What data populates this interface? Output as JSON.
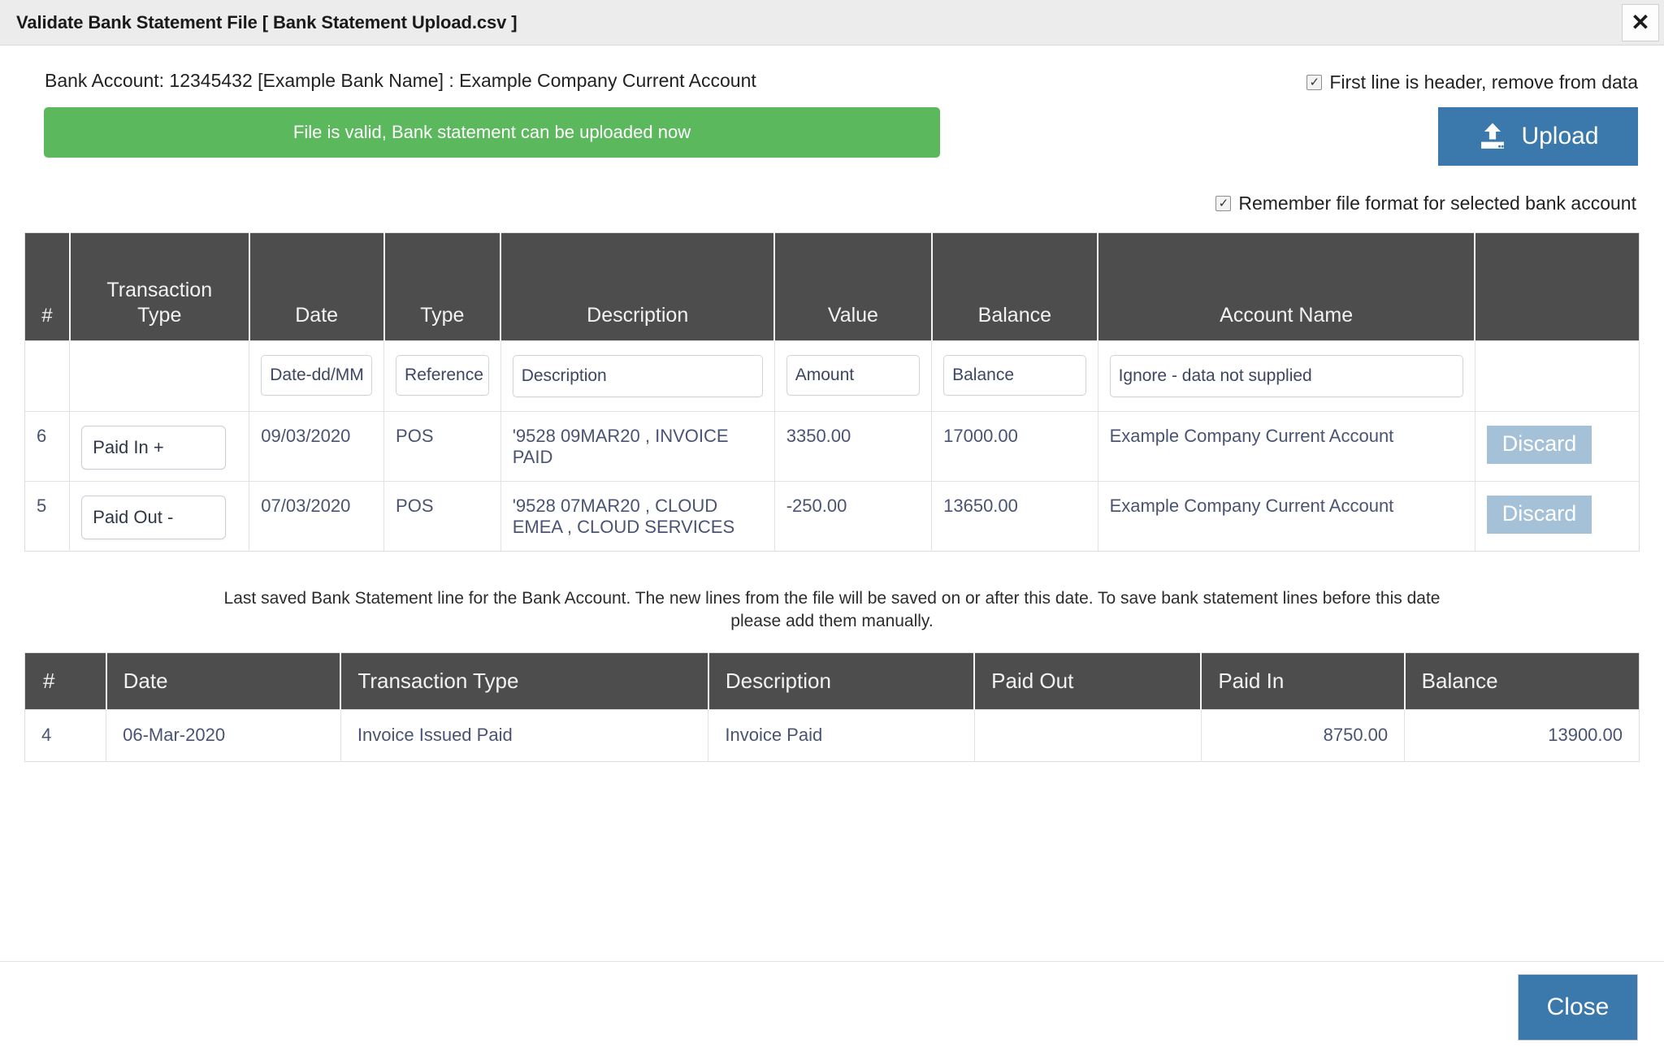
{
  "titlebar": {
    "title": "Validate Bank Statement File [ Bank Statement Upload.csv ]",
    "close_icon": "close-icon",
    "close_glyph": "✕"
  },
  "header": {
    "account_line": "Bank Account: 12345432 [Example Bank Name] : Example Company Current Account",
    "first_line_header_label": "First line is header, remove from data",
    "first_line_header_checked": true,
    "remember_format_label": "Remember file format for selected bank account",
    "remember_format_checked": true
  },
  "banner": {
    "message": "File is valid, Bank statement can be uploaded now",
    "color": "#5cb85c"
  },
  "upload": {
    "label": "Upload",
    "icon": "upload-icon",
    "color": "#3b78ab"
  },
  "mapping_table": {
    "columns": [
      "#",
      "Transaction\nType",
      "Date",
      "Type",
      "Description",
      "Value",
      "Balance",
      "Account Name",
      ""
    ],
    "column_labels": {
      "num": "#",
      "transaction_type_l1": "Transaction",
      "transaction_type_l2": "Type",
      "date": "Date",
      "type": "Type",
      "description": "Description",
      "value": "Value",
      "balance": "Balance",
      "account_name": "Account Name",
      "actions": ""
    },
    "mapping_row": {
      "num": "",
      "transaction_type": "",
      "date": "Date-dd/MM",
      "type": "Reference",
      "description": "Description",
      "value": "Amount",
      "balance": "Balance",
      "account_name": "Ignore - data not supplied",
      "actions": ""
    },
    "rows": [
      {
        "num": "6",
        "transaction_type": "Paid In  +",
        "date": "09/03/2020",
        "type": "POS",
        "description": "'9528 09MAR20 , INVOICE PAID",
        "value": "3350.00",
        "balance": "17000.00",
        "account_name": "Example Company Current Account",
        "action_label": "Discard"
      },
      {
        "num": "5",
        "transaction_type": "Paid Out  -",
        "date": "07/03/2020",
        "type": "POS",
        "description": "'9528 07MAR20 , CLOUD EMEA , CLOUD SERVICES",
        "value": "-250.00",
        "balance": "13650.00",
        "account_name": "Example Company Current Account",
        "action_label": "Discard"
      }
    ]
  },
  "note": "Last saved Bank Statement line for the Bank Account. The new lines from the file will be saved on or after this date. To save bank statement lines before this date please add them manually.",
  "saved_table": {
    "columns": {
      "num": "#",
      "date": "Date",
      "transaction_type": "Transaction Type",
      "description": "Description",
      "paid_out": "Paid Out",
      "paid_in": "Paid In",
      "balance": "Balance"
    },
    "rows": [
      {
        "num": "4",
        "date": "06-Mar-2020",
        "transaction_type": "Invoice Issued Paid",
        "description": "Invoice Paid",
        "paid_out": "",
        "paid_in": "8750.00",
        "balance": "13900.00"
      }
    ]
  },
  "footer": {
    "close_label": "Close",
    "close_color": "#3b78ab"
  }
}
